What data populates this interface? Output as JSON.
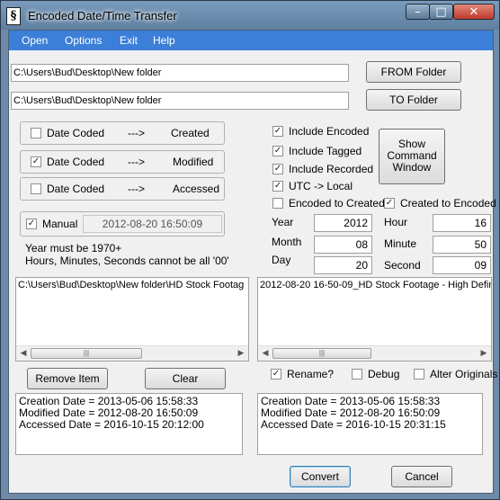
{
  "window": {
    "title": "Encoded Date/Time Transfer",
    "icon": "§",
    "min_glyph": "–",
    "max_glyph": "□",
    "close_glyph": "✕"
  },
  "menu": [
    "Open",
    "Options",
    "Exit",
    "Help"
  ],
  "paths": {
    "from_value": "C:\\Users\\Bud\\Desktop\\New folder",
    "from_button": "FROM Folder",
    "to_value": "C:\\Users\\Bud\\Desktop\\New folder",
    "to_button": "TO Folder"
  },
  "mappings": [
    {
      "label": "Date Coded",
      "arrow": "--->",
      "target": "Created",
      "checked": false
    },
    {
      "label": "Date Coded",
      "arrow": "--->",
      "target": "Modified",
      "checked": true
    },
    {
      "label": "Date Coded",
      "arrow": "--->",
      "target": "Accessed",
      "checked": false
    }
  ],
  "manual": {
    "label": "Manual",
    "checked": true,
    "value": "2012-08-20 16:50:09"
  },
  "notes": [
    "Year must be 1970+",
    "Hours, Minutes, Seconds cannot be all '00'"
  ],
  "options": [
    {
      "label": "Include Encoded",
      "checked": true
    },
    {
      "label": "Include Tagged",
      "checked": true
    },
    {
      "label": "Include Recorded",
      "checked": true
    },
    {
      "label": "UTC -> Local",
      "checked": true
    }
  ],
  "show_command_button": [
    "Show",
    "Command",
    "Window"
  ],
  "encoded_to_created": {
    "label": "Encoded to Created",
    "checked": false
  },
  "created_to_encoded": {
    "label": "Created to Encoded",
    "checked": true
  },
  "datetime": {
    "year_label": "Year",
    "year": "2012",
    "month_label": "Month",
    "month": "08",
    "day_label": "Day",
    "day": "20",
    "hour_label": "Hour",
    "hour": "16",
    "minute_label": "Minute",
    "minute": "50",
    "second_label": "Second",
    "second": "09"
  },
  "left_list": {
    "items": [
      "C:\\Users\\Bud\\Desktop\\New folder\\HD Stock Footag"
    ]
  },
  "right_list": {
    "items": [
      "2012-08-20 16-50-09_HD Stock Footage - High Defini"
    ]
  },
  "scrollbar": {
    "left_arrow": "◀",
    "right_arrow": "▶",
    "grip": "|||"
  },
  "buttons": {
    "remove": "Remove Item",
    "clear": "Clear",
    "convert": "Convert",
    "cancel": "Cancel"
  },
  "flags": [
    {
      "label": "Rename?",
      "checked": true
    },
    {
      "label": "Debug",
      "checked": false
    },
    {
      "label": "Alter Originals",
      "checked": false
    }
  ],
  "left_info": [
    "Creation Date = 2013-05-06 15:58:33",
    "Modified Date = 2012-08-20 16:50:09",
    "Accessed Date = 2016-10-15 20:12:00"
  ],
  "right_info": [
    "Creation Date = 2013-05-06 15:58:33",
    "Modified Date = 2012-08-20 16:50:09",
    "Accessed Date = 2016-10-15 20:31:15"
  ],
  "check_mark": "✓"
}
